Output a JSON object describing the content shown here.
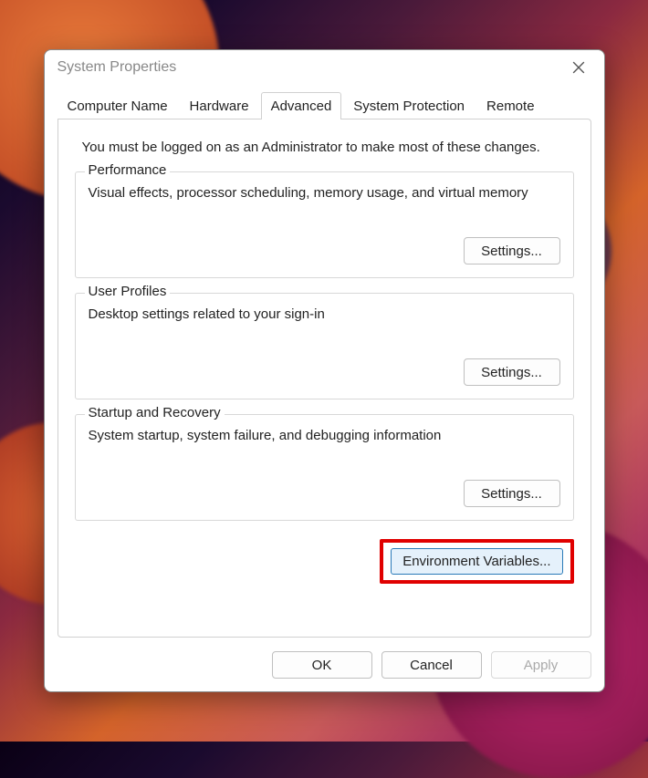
{
  "window": {
    "title": "System Properties"
  },
  "tabs": {
    "computer_name": "Computer Name",
    "hardware": "Hardware",
    "advanced": "Advanced",
    "system_protection": "System Protection",
    "remote": "Remote"
  },
  "intro": "You must be logged on as an Administrator to make most of these changes.",
  "groups": {
    "performance": {
      "title": "Performance",
      "desc": "Visual effects, processor scheduling, memory usage, and virtual memory",
      "button": "Settings..."
    },
    "user_profiles": {
      "title": "User Profiles",
      "desc": "Desktop settings related to your sign-in",
      "button": "Settings..."
    },
    "startup": {
      "title": "Startup and Recovery",
      "desc": "System startup, system failure, and debugging information",
      "button": "Settings..."
    }
  },
  "env_button": "Environment Variables...",
  "actions": {
    "ok": "OK",
    "cancel": "Cancel",
    "apply": "Apply"
  }
}
